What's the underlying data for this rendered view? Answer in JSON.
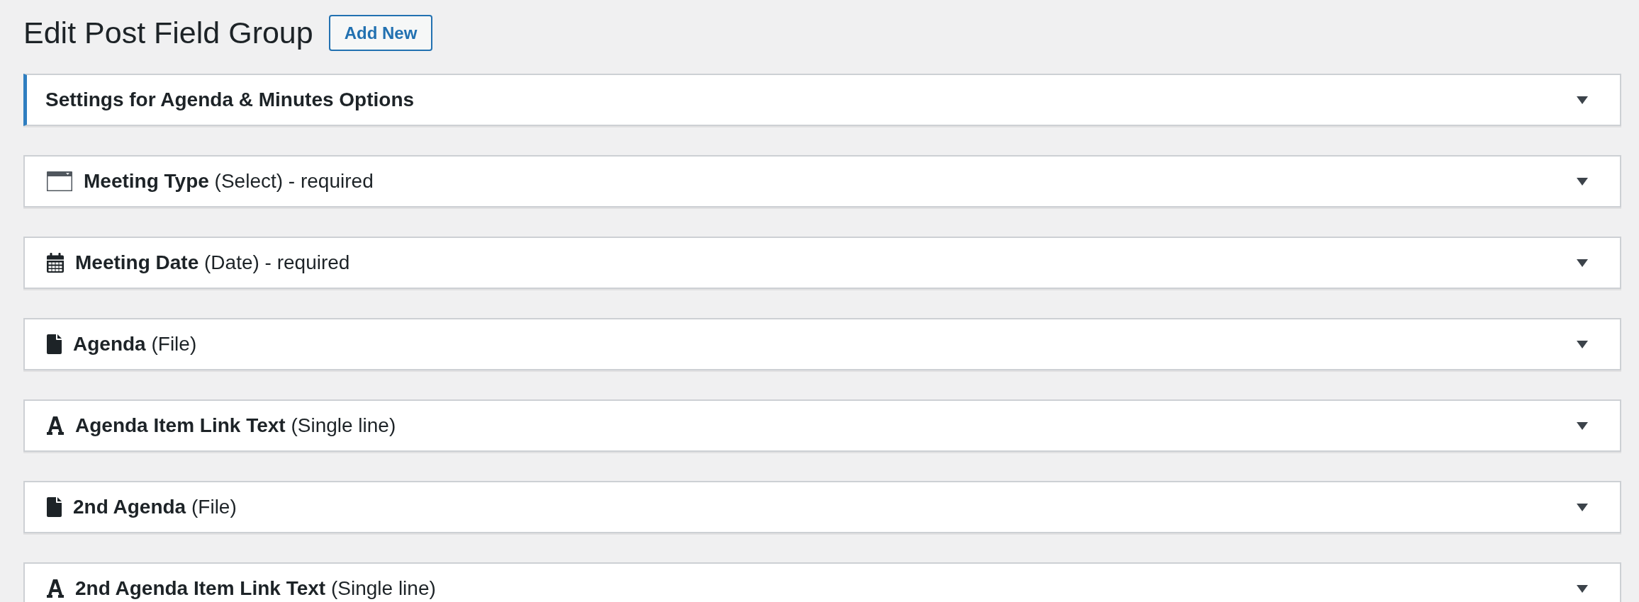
{
  "page_title": "Edit Post Field Group",
  "add_new_button": "Add New",
  "panels": [
    {
      "kind": "settings",
      "label": "Settings for Agenda & Minutes Options",
      "expanded": false
    },
    {
      "kind": "select",
      "label": "**Meeting Type** (Select) - required",
      "expanded": false
    },
    {
      "kind": "date",
      "label": "**Meeting Date** (Date) - required",
      "expanded": false
    },
    {
      "kind": "file",
      "label": "**Agenda** (File)",
      "expanded": false
    },
    {
      "kind": "text",
      "label": "**Agenda Item Link Text** (Single line)",
      "expanded": false
    },
    {
      "kind": "file",
      "label": "**2nd Agenda** (File)",
      "expanded": false
    },
    {
      "kind": "text",
      "label": "**2nd Agenda Item Link Text** (Single line)",
      "expanded": false
    }
  ]
}
